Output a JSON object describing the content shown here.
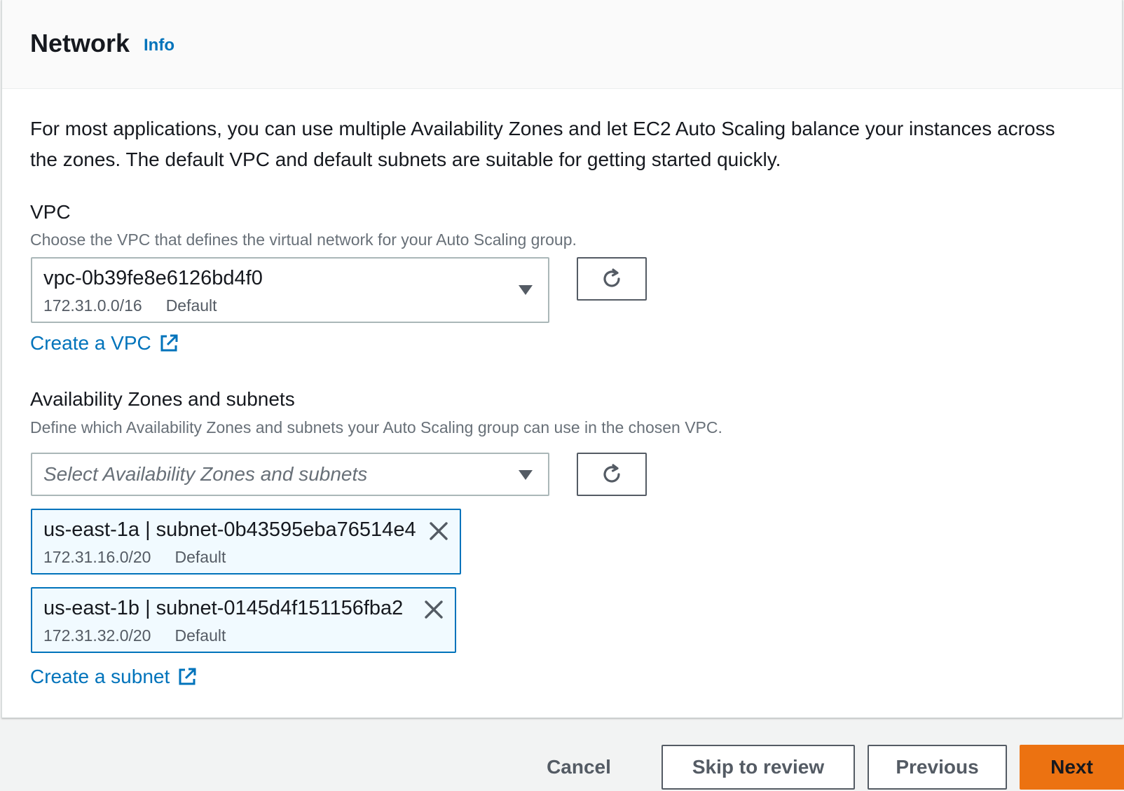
{
  "header": {
    "title": "Network",
    "info_label": "Info"
  },
  "description": "For most applications, you can use multiple Availability Zones and let EC2 Auto Scaling balance your instances across the zones. The default VPC and default subnets are suitable for getting started quickly.",
  "vpc": {
    "label": "VPC",
    "hint": "Choose the VPC that defines the virtual network for your Auto Scaling group.",
    "selected_id": "vpc-0b39fe8e6126bd4f0",
    "selected_cidr": "172.31.0.0/16",
    "selected_tag": "Default",
    "create_link": "Create a VPC"
  },
  "subnets": {
    "label": "Availability Zones and subnets",
    "hint": "Define which Availability Zones and subnets your Auto Scaling group can use in the chosen VPC.",
    "placeholder": "Select Availability Zones and subnets",
    "tokens": [
      {
        "name": "us-east-1a | subnet-0b43595eba76514e4",
        "cidr": "172.31.16.0/20",
        "tag": "Default"
      },
      {
        "name": "us-east-1b | subnet-0145d4f151156fba2",
        "cidr": "172.31.32.0/20",
        "tag": "Default"
      }
    ],
    "create_link": "Create a subnet"
  },
  "footer": {
    "cancel": "Cancel",
    "skip": "Skip to review",
    "previous": "Previous",
    "next": "Next"
  },
  "colors": {
    "link": "#0073bb",
    "primary": "#ec7211",
    "token_border": "#0073bb",
    "token_bg": "#f1faff"
  },
  "icons": {
    "refresh": "refresh-icon",
    "external": "external-link-icon",
    "dismiss": "close-icon",
    "caret": "caret-down-icon"
  }
}
